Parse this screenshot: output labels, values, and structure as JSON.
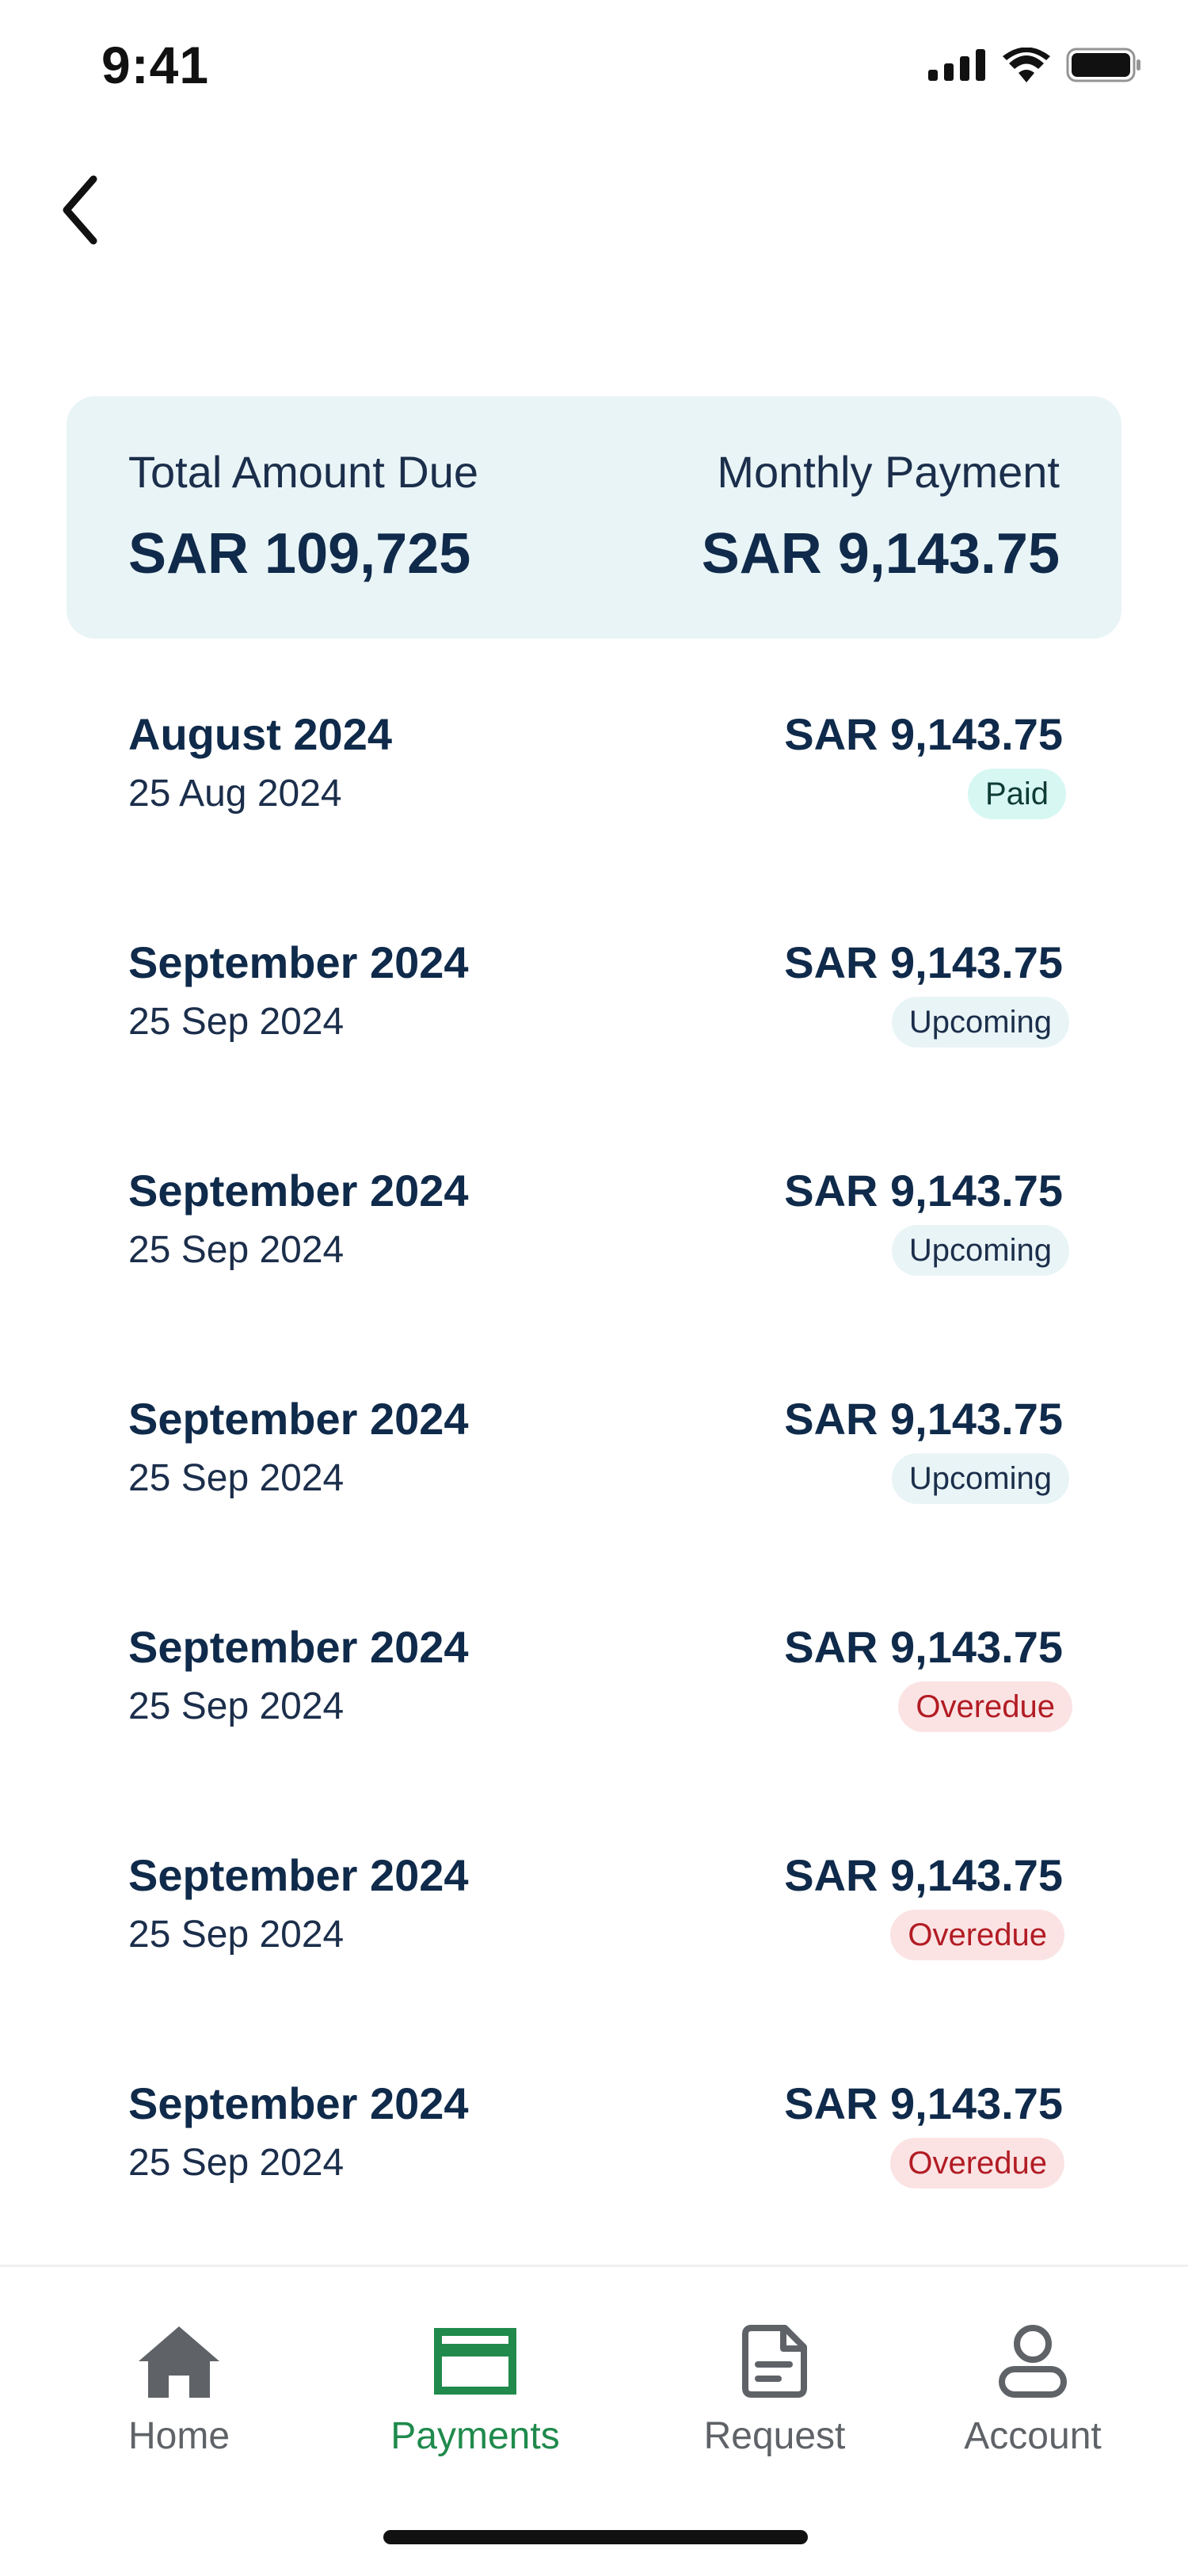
{
  "status_bar": {
    "time": "9:41"
  },
  "summary": {
    "total_label": "Total Amount Due",
    "total_value": "SAR 109,725",
    "monthly_label": "Monthly Payment",
    "monthly_value": "SAR 9,143.75"
  },
  "payments": [
    {
      "month": "August 2024",
      "date": "25 Aug 2024",
      "amount": "SAR 9,143.75",
      "status": "Paid"
    },
    {
      "month": "September 2024",
      "date": "25 Sep 2024",
      "amount": "SAR 9,143.75",
      "status": "Upcoming"
    },
    {
      "month": "September 2024",
      "date": "25 Sep 2024",
      "amount": "SAR 9,143.75",
      "status": "Upcoming"
    },
    {
      "month": "September 2024",
      "date": "25 Sep 2024",
      "amount": "SAR 9,143.75",
      "status": "Upcoming"
    },
    {
      "month": "September 2024",
      "date": "25 Sep 2024",
      "amount": "SAR 9,143.75",
      "status": "Overedue"
    },
    {
      "month": "September 2024",
      "date": "25 Sep 2024",
      "amount": "SAR 9,143.75",
      "status": "Overedue"
    },
    {
      "month": "September 2024",
      "date": "25 Sep 2024",
      "amount": "SAR 9,143.75",
      "status": "Overedue"
    }
  ],
  "nav": {
    "home": "Home",
    "payments": "Payments",
    "request": "Request",
    "account": "Account",
    "active": "payments"
  },
  "colors": {
    "accent_green": "#1f8a4c",
    "card_bg": "#e9f4f6",
    "text_primary": "#0f2a4a",
    "overdue_red": "#b21c24",
    "paid_bg": "#d7f7f3"
  }
}
